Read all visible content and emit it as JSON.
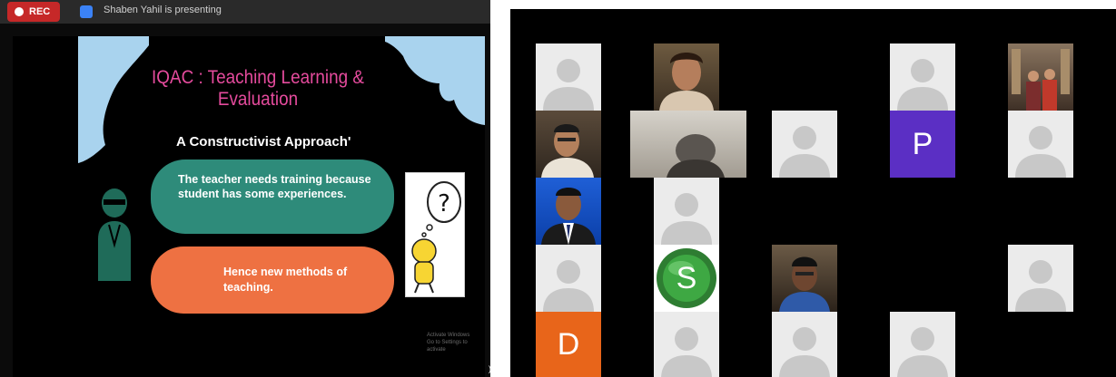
{
  "top_bar": {
    "rec_label": "REC",
    "share_status": "Shaben Yahil is presenting"
  },
  "slide": {
    "title": "IQAC : Teaching Learning & Evaluation",
    "subtitle": "A Constructivist Approach'",
    "teal_box_text": "The teacher needs training because student has some experiences.",
    "orange_box_text": "Hence new methods of teaching.",
    "watermark_line1": "Activate Windows",
    "watermark_line2": "Go to Settings to activate",
    "corner_glyph": ")"
  },
  "gallery": {
    "letter_tiles": [
      "P",
      "S",
      "D"
    ]
  },
  "colors": {
    "rec_red": "#c62828",
    "slide_title_pink": "#e54b9d",
    "teal": "#2e8b7a",
    "orange": "#ee7142",
    "purple_tile": "#5b2fc4",
    "orange_tile": "#e8651a",
    "green_tile": "#2e7d32"
  }
}
